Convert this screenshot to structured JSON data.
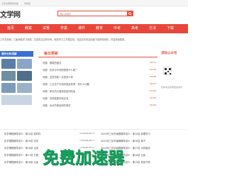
{
  "topbar": {
    "left_text": "工作文库网手机版",
    "mid_text": "手机版"
  },
  "logo": {
    "main": "文学网",
    "sub": "www.com"
  },
  "search": {
    "placeholder": "输入关键字"
  },
  "nav": {
    "items": [
      "首页",
      "教案",
      "试卷",
      "学案",
      "课件",
      "教育",
      "中考",
      "高考",
      "方法",
      "下载"
    ]
  },
  "notice": {
    "text": "工作文库网，汇聚海量学习资源，文档范文应有尽有，助您学习工作更高效，欢迎访问本站阅读下载所需资料，内容持续更新。"
  },
  "sidebox": {
    "head": "课外分科讲解"
  },
  "news": {
    "title": "每日更新",
    "rows": [
      {
        "title": "问题：蛋糕的做法",
        "date": "02-11"
      },
      {
        "title": "问题：化学中不同的物质什么呢？",
        "date": "02-09"
      },
      {
        "title": "问题：这些贷款一共是多少钱",
        "date": "02-08"
      },
      {
        "title": "问题：工业生产中如何提高效率，有什么问题",
        "date": "02-07"
      },
      {
        "title": "问题：家长的价值观该如何改善",
        "date": "02-06"
      },
      {
        "title": "问题：怎样能更好地交流",
        "date": "02-05"
      },
      {
        "title": "问题：冰冰竹熊如何的事件",
        "date": "02-04"
      }
    ]
  },
  "rightbox": {
    "head": "求知公众号",
    "foot": "扫码关注获取更多资讯"
  },
  "list_left": [
    {
      "title": "化学课程辅导讲义：第20讲 原材料",
      "date": "2024-01-12"
    },
    {
      "title": "化学课程辅导讲义：第19讲 化学",
      "date": "2024-01-12"
    },
    {
      "title": "化学课程辅导讲义：第18讲 合成",
      "date": "2024-01-11"
    },
    {
      "title": "化学课程辅导讲义：第17讲 方程",
      "date": "2024-01-11"
    },
    {
      "title": "化学课程辅导讲义：第16讲 元素",
      "date": "2024-01-10"
    }
  ],
  "list_right": [
    {
      "title": "2024年三化学暑假辅导讲义：第19讲 原理学习",
      "date": "2024-01-12"
    },
    {
      "title": "2024年三化学暑假辅导讲义：第18讲 离子",
      "date": "2024-01-12"
    },
    {
      "title": "2024年三化学暑假辅导讲义：第17讲 水的组成",
      "date": "2024-01-11"
    },
    {
      "title": "2024年三化学暑假辅导讲义：第16讲 元素",
      "date": "2024-01-11"
    },
    {
      "title": "2024年三化学暑假辅导讲义：第15讲 质量守恒",
      "date": "2024-01-10"
    }
  ],
  "watermark": {
    "text": "免费加速器"
  },
  "colors": {
    "brand_red": "#e8463a",
    "side_blue": "#3a6fd3",
    "watermark_green": "#18a05e"
  }
}
